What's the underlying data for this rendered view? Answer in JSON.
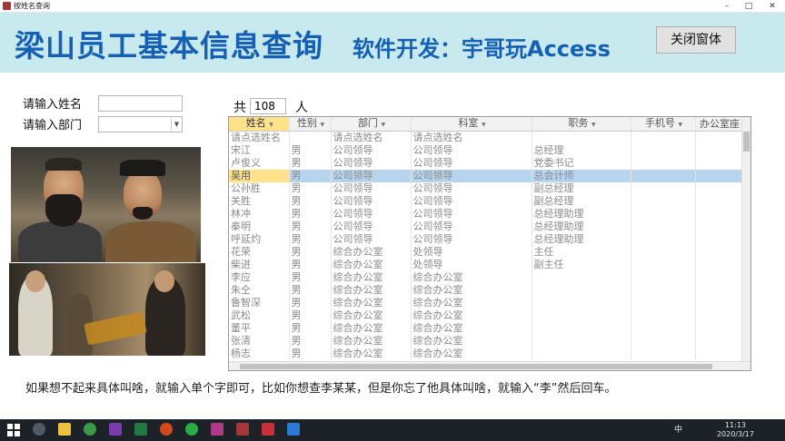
{
  "window": {
    "title": "按姓名查询"
  },
  "header": {
    "main_title": "梁山员工基本信息查询",
    "sub_title": "软件开发：宇哥玩Access",
    "close_label": "关闭窗体"
  },
  "search": {
    "name_label": "请输入姓名",
    "name_value": "",
    "dept_label": "请输入部门",
    "dept_value": ""
  },
  "count": {
    "prefix": "共",
    "value": "108",
    "suffix": "人"
  },
  "table": {
    "columns": [
      "姓名",
      "性别",
      "部门",
      "科室",
      "职务",
      "手机号",
      "办公室座"
    ],
    "rows": [
      [
        "请点选姓名",
        "",
        "请点选姓名",
        "请点选姓名",
        "",
        "",
        ""
      ],
      [
        "宋江",
        "男",
        "公司领导",
        "公司领导",
        "总经理",
        "",
        ""
      ],
      [
        "卢俊义",
        "男",
        "公司领导",
        "公司领导",
        "党委书记",
        "",
        ""
      ],
      [
        "吴用",
        "男",
        "公司领导",
        "公司领导",
        "总会计师",
        "",
        ""
      ],
      [
        "公孙胜",
        "男",
        "公司领导",
        "公司领导",
        "副总经理",
        "",
        ""
      ],
      [
        "关胜",
        "男",
        "公司领导",
        "公司领导",
        "副总经理",
        "",
        ""
      ],
      [
        "林冲",
        "男",
        "公司领导",
        "公司领导",
        "总经理助理",
        "",
        ""
      ],
      [
        "秦明",
        "男",
        "公司领导",
        "公司领导",
        "总经理助理",
        "",
        ""
      ],
      [
        "呼延灼",
        "男",
        "公司领导",
        "公司领导",
        "总经理助理",
        "",
        ""
      ],
      [
        "花荣",
        "男",
        "综合办公室",
        "处领导",
        "主任",
        "",
        ""
      ],
      [
        "柴进",
        "男",
        "综合办公室",
        "处领导",
        "副主任",
        "",
        ""
      ],
      [
        "李应",
        "男",
        "综合办公室",
        "综合办公室",
        "",
        "",
        ""
      ],
      [
        "朱仝",
        "男",
        "综合办公室",
        "综合办公室",
        "",
        "",
        ""
      ],
      [
        "鲁智深",
        "男",
        "综合办公室",
        "综合办公室",
        "",
        "",
        ""
      ],
      [
        "武松",
        "男",
        "综合办公室",
        "综合办公室",
        "",
        "",
        ""
      ],
      [
        "董平",
        "男",
        "综合办公室",
        "综合办公室",
        "",
        "",
        ""
      ],
      [
        "张清",
        "男",
        "综合办公室",
        "综合办公室",
        "",
        "",
        ""
      ],
      [
        "杨志",
        "男",
        "综合办公室",
        "综合办公室",
        "",
        "",
        ""
      ]
    ],
    "selected_row": 3
  },
  "hint": "如果想不起来具体叫啥，就输入单个字即可，比如你想查李某某，但是你忘了他具体叫啥，就输入“李”然后回车。",
  "taskbar": {
    "ime": "中",
    "time": "11:13",
    "date": "2020/3/17"
  },
  "icons": {
    "app": "access-app-icon",
    "windows": "windows-start-icon"
  }
}
